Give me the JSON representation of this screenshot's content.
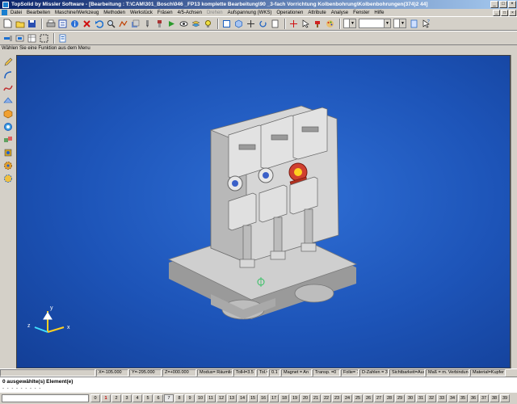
{
  "window": {
    "title": "TopSolid by Missler Software - [Bearbeitung : T:\\CAM\\301_Bosch\\046 _FP13 komplette Bearbeitung\\90 _3-fach Vorrichtung Kolbenbohrung\\Kolbenbohrungen(374)2 44]",
    "minimize": "_",
    "maximize": "□",
    "close": "×"
  },
  "menu": {
    "items": [
      {
        "label": "Datei",
        "enabled": true
      },
      {
        "label": "Bearbeiten",
        "enabled": true
      },
      {
        "label": "Maschine/Werkzeug",
        "enabled": true
      },
      {
        "label": "Methoden",
        "enabled": true
      },
      {
        "label": "Werkstück",
        "enabled": true
      },
      {
        "label": "Fräsen",
        "enabled": true
      },
      {
        "label": "4/5-Achsen",
        "enabled": true
      },
      {
        "label": "Drehen",
        "enabled": false
      },
      {
        "label": "Aufspannung (WKS)",
        "enabled": true
      },
      {
        "label": "Operationen",
        "enabled": true
      },
      {
        "label": "Attribute",
        "enabled": true
      },
      {
        "label": "Analyse",
        "enabled": true
      },
      {
        "label": "Fenster",
        "enabled": true
      },
      {
        "label": "Hilfe",
        "enabled": true
      }
    ]
  },
  "prompt": "Wählen Sie eine Funktion aus dem Menu",
  "status": {
    "x": "X=-105.000",
    "y": "Y=-295.000",
    "z": "Z=+000.000",
    "modus": "Modus= Räumlich",
    "tol": "TolH=3.5",
    "tolv": "Tol.=",
    "tolval": "0.1",
    "magnet": "Magnet = An",
    "transp": "Transp. =0",
    "folie": "Folie= 7",
    "dzahlen": "D-Zahlen = 3",
    "sicht": "Sichtbarkeit=Aus",
    "mass": "Maß = m. Verbindung",
    "material": "Material=Kupfer"
  },
  "selection": {
    "text": "0 ausgewählte(s) Element(e)",
    "dashes": "- - - - - - - - -"
  },
  "layers": [
    "0",
    "1",
    "2",
    "3",
    "4",
    "5",
    "6",
    "7",
    "8",
    "9",
    "10",
    "11",
    "12",
    "13",
    "14",
    "15",
    "16",
    "17",
    "18",
    "19",
    "20",
    "21",
    "22",
    "23",
    "24",
    "25",
    "26",
    "27",
    "28",
    "29",
    "30",
    "31",
    "32",
    "33",
    "34",
    "35",
    "36",
    "37",
    "38",
    "39"
  ],
  "axis": {
    "x": "x",
    "y": "y",
    "z": "z"
  }
}
